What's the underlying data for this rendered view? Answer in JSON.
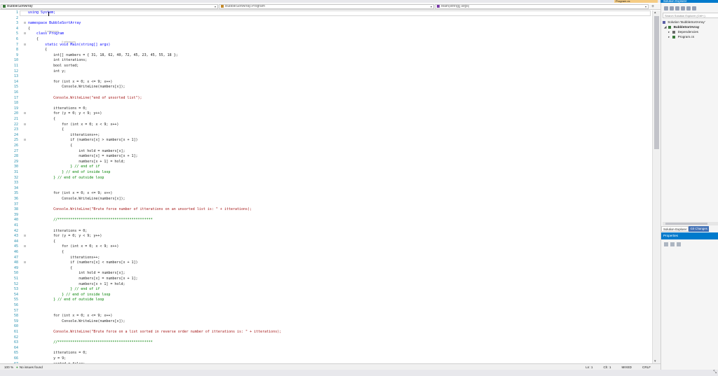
{
  "window": {
    "active_tab": "Program.cs",
    "solution_explorer_title": "Solution Explorer"
  },
  "nav": {
    "project": "BubbleSortArray",
    "class": "BubbleSortArray.Program",
    "member": "Main(string[] args)"
  },
  "code": {
    "lines": [
      {
        "n": "1",
        "t": "using System;",
        "c": "kw"
      },
      {
        "n": "2",
        "t": "",
        "c": ""
      },
      {
        "n": "3",
        "t": "namespace BubbleSortArray",
        "c": "kw"
      },
      {
        "n": "4",
        "t": "{",
        "c": ""
      },
      {
        "n": "5",
        "t": "    class Program",
        "c": "kw"
      },
      {
        "n": "6",
        "t": "    {",
        "c": ""
      },
      {
        "n": "7",
        "t": "        static void Main(string[] args)",
        "c": "kw"
      },
      {
        "n": "8",
        "t": "        {",
        "c": ""
      },
      {
        "n": "9",
        "t": "            int[] numbers = { 31, 18, 62, 40, 72, 45, 23, 45, 55, 18 };",
        "c": ""
      },
      {
        "n": "10",
        "t": "            int itterations;",
        "c": ""
      },
      {
        "n": "11",
        "t": "            bool sorted;",
        "c": ""
      },
      {
        "n": "12",
        "t": "            int y;",
        "c": ""
      },
      {
        "n": "13",
        "t": "",
        "c": ""
      },
      {
        "n": "14",
        "t": "            for (int x = 0; x <= 9; x++)",
        "c": ""
      },
      {
        "n": "15",
        "t": "                Console.WriteLine(numbers[x]);",
        "c": ""
      },
      {
        "n": "16",
        "t": "",
        "c": ""
      },
      {
        "n": "17",
        "t": "            Console.WriteLine(\"end of unsorted list\");",
        "c": "str"
      },
      {
        "n": "18",
        "t": "",
        "c": ""
      },
      {
        "n": "19",
        "t": "            itterations = 0;",
        "c": ""
      },
      {
        "n": "20",
        "t": "            for (y = 0; y < 9; y++)",
        "c": ""
      },
      {
        "n": "21",
        "t": "            {",
        "c": ""
      },
      {
        "n": "22",
        "t": "                for (int x = 0; x < 9; x++)",
        "c": ""
      },
      {
        "n": "23",
        "t": "                {",
        "c": ""
      },
      {
        "n": "24",
        "t": "                    itterations++;",
        "c": ""
      },
      {
        "n": "25",
        "t": "                    if (numbers[x] > numbers[x + 1])",
        "c": ""
      },
      {
        "n": "26",
        "t": "                    {",
        "c": ""
      },
      {
        "n": "27",
        "t": "                        int hold = numbers[x];",
        "c": ""
      },
      {
        "n": "28",
        "t": "                        numbers[x] = numbers[x + 1];",
        "c": ""
      },
      {
        "n": "29",
        "t": "                        numbers[x + 1] = hold;",
        "c": ""
      },
      {
        "n": "30",
        "t": "                    } // end of if",
        "c": "cm"
      },
      {
        "n": "31",
        "t": "                } // end of inside loop",
        "c": "cm"
      },
      {
        "n": "32",
        "t": "            } // end of outside loop",
        "c": "cm"
      },
      {
        "n": "33",
        "t": "",
        "c": ""
      },
      {
        "n": "34",
        "t": "",
        "c": ""
      },
      {
        "n": "35",
        "t": "            for (int x = 0; x <= 9; x++)",
        "c": ""
      },
      {
        "n": "36",
        "t": "                Console.WriteLine(numbers[x]);",
        "c": ""
      },
      {
        "n": "37",
        "t": "",
        "c": ""
      },
      {
        "n": "38",
        "t": "            Console.WriteLine(\"Brute force number of itterations on an unsorted list is: \" + itterations);",
        "c": "str"
      },
      {
        "n": "39",
        "t": "",
        "c": ""
      },
      {
        "n": "40",
        "t": "            //*********************************************",
        "c": "cm"
      },
      {
        "n": "41",
        "t": "",
        "c": ""
      },
      {
        "n": "42",
        "t": "            itterations = 0;",
        "c": ""
      },
      {
        "n": "43",
        "t": "            for (y = 0; y < 9; y++)",
        "c": ""
      },
      {
        "n": "44",
        "t": "            {",
        "c": ""
      },
      {
        "n": "45",
        "t": "                for (int x = 0; x < 9; x++)",
        "c": ""
      },
      {
        "n": "46",
        "t": "                {",
        "c": ""
      },
      {
        "n": "47",
        "t": "                    itterations++;",
        "c": ""
      },
      {
        "n": "48",
        "t": "                    if (numbers[x] < numbers[x + 1])",
        "c": ""
      },
      {
        "n": "49",
        "t": "                    {",
        "c": ""
      },
      {
        "n": "50",
        "t": "                        int hold = numbers[x];",
        "c": ""
      },
      {
        "n": "51",
        "t": "                        numbers[x] = numbers[x + 1];",
        "c": ""
      },
      {
        "n": "52",
        "t": "                        numbers[x + 1] = hold;",
        "c": ""
      },
      {
        "n": "53",
        "t": "                    } // end of if",
        "c": "cm"
      },
      {
        "n": "54",
        "t": "                } // end of inside loop",
        "c": "cm"
      },
      {
        "n": "55",
        "t": "            } // end of outside loop",
        "c": "cm"
      },
      {
        "n": "56",
        "t": "",
        "c": ""
      },
      {
        "n": "57",
        "t": "",
        "c": ""
      },
      {
        "n": "58",
        "t": "            for (int x = 0; x <= 9; x++)",
        "c": ""
      },
      {
        "n": "59",
        "t": "                Console.WriteLine(numbers[x]);",
        "c": ""
      },
      {
        "n": "60",
        "t": "",
        "c": ""
      },
      {
        "n": "61",
        "t": "            Console.WriteLine(\"Brute force on a list sorted in reverse order number of itterations is: \" + itterations);",
        "c": "str"
      },
      {
        "n": "62",
        "t": "",
        "c": ""
      },
      {
        "n": "63",
        "t": "            //*********************************************",
        "c": "cm"
      },
      {
        "n": "64",
        "t": "",
        "c": ""
      },
      {
        "n": "65",
        "t": "            itterations = 0;",
        "c": ""
      },
      {
        "n": "66",
        "t": "            y = 9;",
        "c": ""
      },
      {
        "n": "67",
        "t": "            sorted = false;",
        "c": ""
      }
    ],
    "ref_lens_class": "0 references",
    "ref_lens_main": "0 references"
  },
  "status": {
    "zoom": "100 %",
    "issues": "No issues found",
    "ln": "Ln: 1",
    "ch": "Ch: 1",
    "mixed": "MIXED",
    "crlf": "CRLF"
  },
  "solution_explorer": {
    "search_placeholder": "Search Solution Explorer (Ctrl+;)",
    "items": [
      {
        "label": "Solution 'BubbleSortArray'"
      },
      {
        "label": "BubbleSortArray"
      },
      {
        "label": "Dependencies"
      },
      {
        "label": "Program.cs"
      }
    ],
    "tab_active": "Solution Explorer",
    "tab_inactive": "Git Changes"
  },
  "properties": {
    "title": "Properties"
  },
  "colors": {
    "accent": "#007acc",
    "keyword": "#0000ff",
    "comment": "#008000",
    "string": "#a31515",
    "line_number": "#2b91af"
  }
}
